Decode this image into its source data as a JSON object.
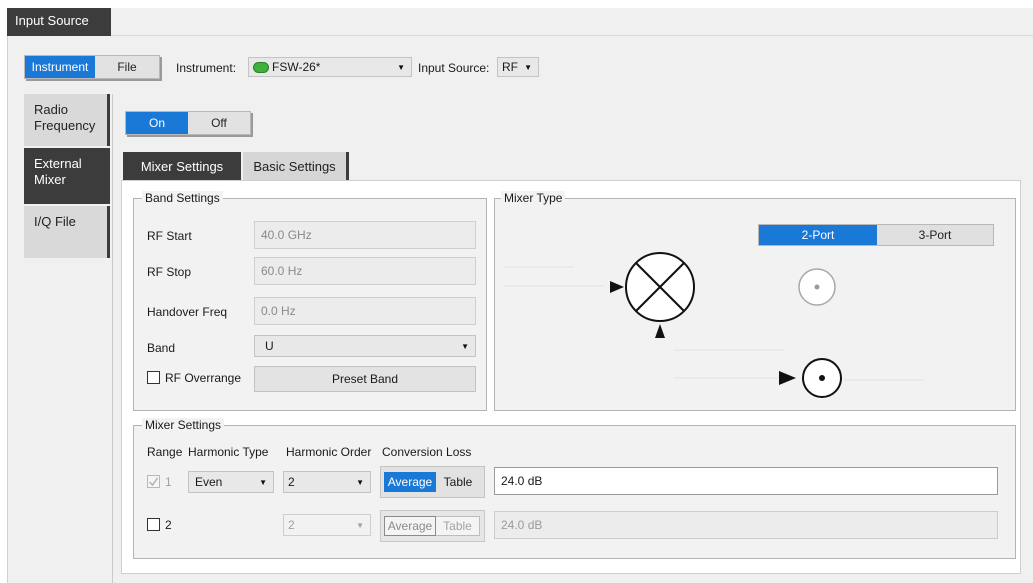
{
  "window": {
    "title": "Input Source"
  },
  "source_toggle": {
    "instrument": "Instrument",
    "file": "File",
    "active": "Instrument"
  },
  "instrument": {
    "label": "Instrument:",
    "value": "FSW-26*",
    "status_color": "#3fb13f"
  },
  "input_source": {
    "label": "Input Source:",
    "value": "RF"
  },
  "side_tabs": [
    {
      "label": "Radio\nFrequency"
    },
    {
      "label": "External\nMixer",
      "active": true
    },
    {
      "label": "I/Q File"
    }
  ],
  "state_toggle": {
    "on": "On",
    "off": "Off",
    "active": "On"
  },
  "inner_tabs": {
    "mixer": "Mixer Settings",
    "basic": "Basic Settings",
    "active": "Mixer Settings"
  },
  "band_settings": {
    "title": "Band Settings",
    "rf_start": {
      "label": "RF Start",
      "value": "40.0 GHz"
    },
    "rf_stop": {
      "label": "RF Stop",
      "value": "60.0 Hz"
    },
    "handover": {
      "label": "Handover Freq",
      "value": "0.0 Hz"
    },
    "band": {
      "label": "Band",
      "value": "U"
    },
    "rf_overrange": "RF Overrange",
    "preset_band": "Preset Band"
  },
  "mixer_type": {
    "title": "Mixer Type",
    "two_port": "2-Port",
    "three_port": "3-Port",
    "active": "2-Port"
  },
  "mixer_settings": {
    "title": "Mixer Settings",
    "headers": {
      "range": "Range",
      "harmonic_type": "Harmonic Type",
      "harmonic_order": "Harmonic Order",
      "conversion_loss": "Conversion Loss"
    },
    "rows": [
      {
        "range": "1",
        "harmonic_type": "Even",
        "harmonic_order": "2",
        "mode_average": "Average",
        "mode_table": "Table",
        "loss": "24.0 dB"
      },
      {
        "range": "2",
        "harmonic_order": "2",
        "mode_average": "Average",
        "mode_table": "Table",
        "loss": "24.0 dB"
      }
    ]
  },
  "colors": {
    "accent": "#1a78d6",
    "dark_tab": "#3c3c3c",
    "panel": "#f0f0f0"
  }
}
